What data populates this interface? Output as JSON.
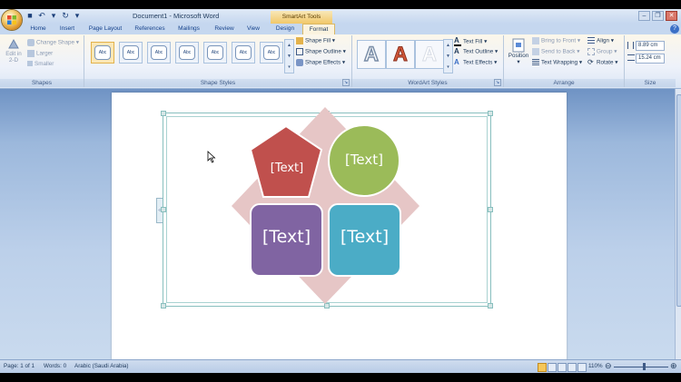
{
  "window": {
    "title": "Document1 - Microsoft Word",
    "contextual_tool": "SmartArt Tools"
  },
  "tabs": [
    {
      "label": "Home"
    },
    {
      "label": "Insert"
    },
    {
      "label": "Page Layout"
    },
    {
      "label": "References"
    },
    {
      "label": "Mailings"
    },
    {
      "label": "Review"
    },
    {
      "label": "View"
    },
    {
      "label": "Design"
    },
    {
      "label": "Format"
    }
  ],
  "active_tab": "Format",
  "ribbon": {
    "shapes": {
      "label": "Shapes",
      "edit_2d": "Edit in 2-D",
      "change_shape": "Change Shape",
      "larger": "Larger",
      "smaller": "Smaller"
    },
    "shape_styles": {
      "label": "Shape Styles",
      "thumb_text": "Abc",
      "shape_fill": "Shape Fill",
      "shape_outline": "Shape Outline",
      "shape_effects": "Shape Effects"
    },
    "wordart_styles": {
      "label": "WordArt Styles",
      "glyph": "A",
      "text_fill": "Text Fill",
      "text_outline": "Text Outline",
      "text_effects": "Text Effects"
    },
    "arrange": {
      "label": "Arrange",
      "position": "Position",
      "bring_to_front": "Bring to Front",
      "send_to_back": "Send to Back",
      "text_wrapping": "Text Wrapping",
      "align": "Align",
      "group": "Group",
      "rotate": "Rotate"
    },
    "size": {
      "label": "Size",
      "height": "8.89 cm",
      "width": "15.24 cm"
    }
  },
  "smartart": {
    "shapes": [
      {
        "text": "[Text]",
        "color": "#c0504d"
      },
      {
        "text": "[Text]",
        "color": "#9bbb59"
      },
      {
        "text": "[Text]",
        "color": "#8064a2"
      },
      {
        "text": "[Text]",
        "color": "#4bacc6"
      }
    ],
    "background_color": "#e6c6c6"
  },
  "status": {
    "page": "Page: 1 of 1",
    "words": "Words: 0",
    "language": "Arabic (Saudi Arabia)",
    "zoom": "110%"
  }
}
